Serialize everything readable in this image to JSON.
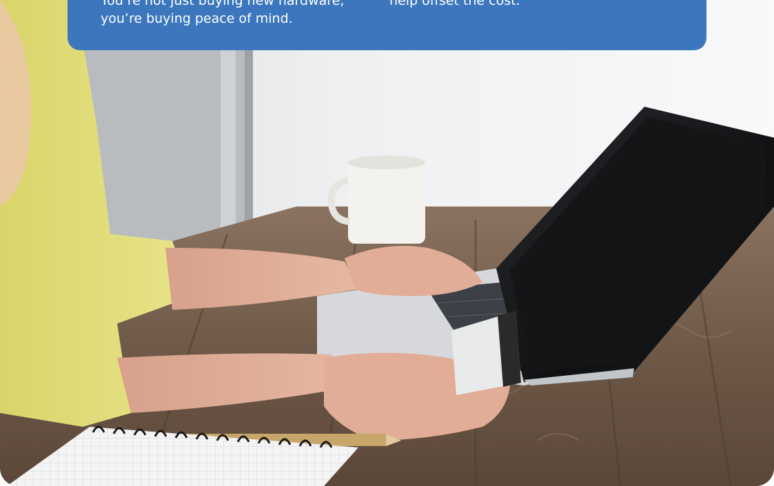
{
  "banner": {
    "left_lines": [
      "You’re not just buying new hardware,",
      "you’re buying peace of mind."
    ],
    "right_lines": [
      "",
      "help offset the cost."
    ],
    "background_color": "#3c77bd",
    "text_color": "#ffffff"
  },
  "photo": {
    "icons": [
      "woman-icon",
      "laptop-icon",
      "credit-card-icon",
      "mug-icon",
      "notebook-icon",
      "pencil-icon"
    ]
  }
}
